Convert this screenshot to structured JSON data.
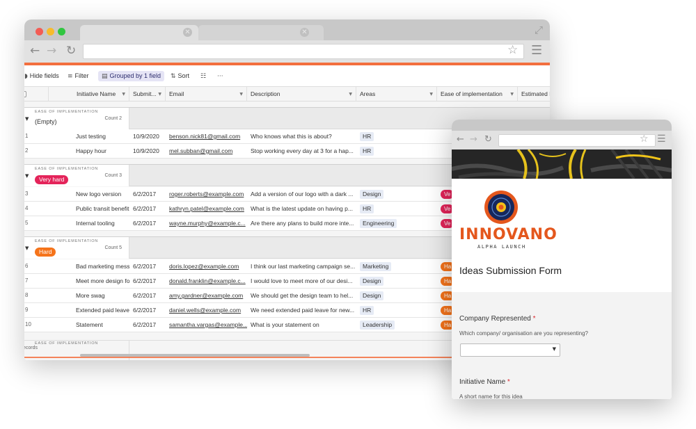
{
  "toolbar": {
    "hide_fields": "Hide fields",
    "filter": "Filter",
    "grouped": "Grouped by 1 field",
    "sort": "Sort"
  },
  "columns": {
    "name": "Initiative Name",
    "submitted": "Submit...",
    "email": "Email",
    "description": "Description",
    "areas": "Areas",
    "ease": "Ease of implementation",
    "estimated": "Estimated I"
  },
  "groups": [
    {
      "caption": "EASE OF IMPLEMENTATION",
      "value": "(Empty)",
      "count": "Count 2",
      "rows": [
        {
          "num": "1",
          "name": "Just testing",
          "date": "10/9/2020",
          "email": "benson.nick81@gmail.com",
          "desc": "Who knows what this is about?",
          "area": "HR",
          "ease": ""
        },
        {
          "num": "2",
          "name": "Happy hour",
          "date": "10/9/2020",
          "email": "mel.subban@gmail.com",
          "desc": "Stop working every day at 3 for a hap...",
          "area": "HR",
          "ease": ""
        }
      ]
    },
    {
      "caption": "EASE OF IMPLEMENTATION",
      "value": "Very hard",
      "count": "Count 3",
      "rows": [
        {
          "num": "3",
          "name": "New logo version",
          "date": "6/2/2017",
          "email": "roger.roberts@example.com",
          "desc": "Add a version of our logo with a dark ...",
          "area": "Design",
          "ease": "Ve"
        },
        {
          "num": "4",
          "name": "Public transit benefit",
          "date": "6/2/2017",
          "email": "kathryn.patel@example.com",
          "desc": "What is the latest update on having p...",
          "area": "HR",
          "ease": "Ve"
        },
        {
          "num": "5",
          "name": "Internal tooling",
          "date": "6/2/2017",
          "email": "wayne.murphy@example.c...",
          "desc": "Are there any plans to build more inte...",
          "area": "Engineering",
          "ease": "Ve"
        }
      ]
    },
    {
      "caption": "EASE OF IMPLEMENTATION",
      "value": "Hard",
      "count": "Count 5",
      "rows": [
        {
          "num": "6",
          "name": "Bad marketing message",
          "date": "6/2/2017",
          "email": "doris.lopez@example.com",
          "desc": "I think our last marketing campaign se...",
          "area": "Marketing",
          "ease": "Ha"
        },
        {
          "num": "7",
          "name": "Meet more design folks",
          "date": "6/2/2017",
          "email": "donald.franklin@example.c...",
          "desc": "I would love to meet more of our desi...",
          "area": "Design",
          "ease": "Ha"
        },
        {
          "num": "8",
          "name": "More swag",
          "date": "6/2/2017",
          "email": "amy.gardner@example.com",
          "desc": "We should get the design team to hel...",
          "area": "Design",
          "ease": "Ha"
        },
        {
          "num": "9",
          "name": "Extended paid leave",
          "date": "6/2/2017",
          "email": "daniel.wells@example.com",
          "desc": "We need extended paid leave for new...",
          "area": "HR",
          "ease": "Ha"
        },
        {
          "num": "10",
          "name": "Statement",
          "date": "6/2/2017",
          "email": "samantha.vargas@example...",
          "desc": "What is your statement on",
          "area": "Leadership",
          "ease": "Ha"
        }
      ]
    }
  ],
  "last_group_caption": "EASE OF IMPLEMENTATION",
  "records_label": "ecords",
  "colors": {
    "accent": "#f36f3e",
    "very_hard": "#e4245a",
    "hard": "#f5731a",
    "brand": "#e4571d"
  },
  "icons": [
    "back-icon",
    "forward-icon",
    "reload-icon",
    "star-icon",
    "menu-icon",
    "expand-icon",
    "eye-off-icon",
    "filter-icon",
    "group-icon",
    "sort-icon",
    "row-height-icon",
    "more-icon",
    "chevron-down-icon"
  ],
  "form": {
    "brand_name": "INNOVANO",
    "brand_sub": "ALPHA LAUNCH",
    "title": "Ideas Submission Form",
    "q1_label": "Company Represented",
    "q1_help": "Which company/ organisation are you representing?",
    "q2_label": "Initiative Name",
    "q2_help": "A short name for this idea",
    "required_mark": "*"
  }
}
